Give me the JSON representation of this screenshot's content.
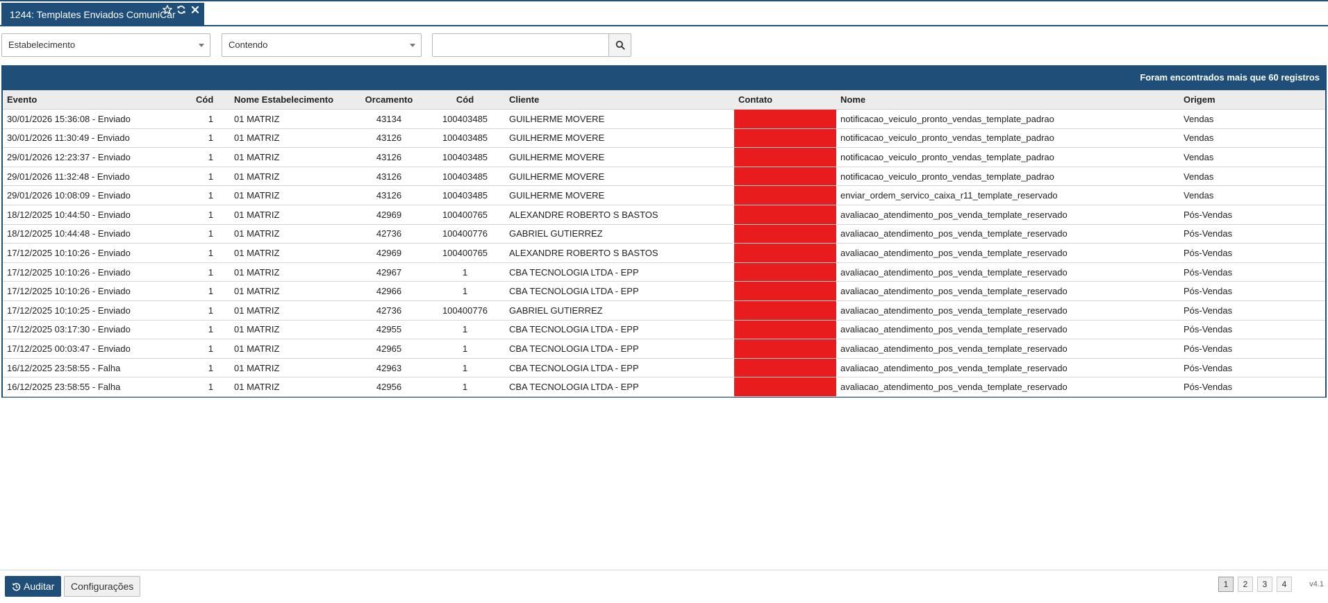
{
  "tab": {
    "title": "1244: Templates Enviados ComuniCar",
    "icons": [
      "star-icon",
      "refresh-icon",
      "close-icon"
    ]
  },
  "filters": {
    "establishment_select": "Estabelecimento",
    "condition_select": "Contendo",
    "search_value": "",
    "search_icon": "search-icon"
  },
  "results": {
    "header_message": "Foram encontrados mais que 60 registros",
    "columns": [
      "Evento",
      "Cód",
      "Nome Estabelecimento",
      "Orcamento",
      "Cód",
      "Cliente",
      "Contato",
      "Nome",
      "Origem"
    ],
    "rows": [
      [
        "30/01/2026 15:36:08 - Enviado",
        "1",
        "01 MATRIZ",
        "43134",
        "100403485",
        "GUILHERME MOVERE",
        "",
        "notificacao_veiculo_pronto_vendas_template_padrao",
        "Vendas"
      ],
      [
        "30/01/2026 11:30:49 - Enviado",
        "1",
        "01 MATRIZ",
        "43126",
        "100403485",
        "GUILHERME MOVERE",
        "",
        "notificacao_veiculo_pronto_vendas_template_padrao",
        "Vendas"
      ],
      [
        "29/01/2026 12:23:37 - Enviado",
        "1",
        "01 MATRIZ",
        "43126",
        "100403485",
        "GUILHERME MOVERE",
        "",
        "notificacao_veiculo_pronto_vendas_template_padrao",
        "Vendas"
      ],
      [
        "29/01/2026 11:32:48 - Enviado",
        "1",
        "01 MATRIZ",
        "43126",
        "100403485",
        "GUILHERME MOVERE",
        "",
        "notificacao_veiculo_pronto_vendas_template_padrao",
        "Vendas"
      ],
      [
        "29/01/2026 10:08:09 - Enviado",
        "1",
        "01 MATRIZ",
        "43126",
        "100403485",
        "GUILHERME MOVERE",
        "",
        "enviar_ordem_servico_caixa_r11_template_reservado",
        "Vendas"
      ],
      [
        "18/12/2025 10:44:50 - Enviado",
        "1",
        "01 MATRIZ",
        "42969",
        "100400765",
        "ALEXANDRE ROBERTO S BASTOS",
        "",
        "avaliacao_atendimento_pos_venda_template_reservado",
        "Pós-Vendas"
      ],
      [
        "18/12/2025 10:44:48 - Enviado",
        "1",
        "01 MATRIZ",
        "42736",
        "100400776",
        "GABRIEL GUTIERREZ",
        "",
        "avaliacao_atendimento_pos_venda_template_reservado",
        "Pós-Vendas"
      ],
      [
        "17/12/2025 10:10:26 - Enviado",
        "1",
        "01 MATRIZ",
        "42969",
        "100400765",
        "ALEXANDRE ROBERTO S BASTOS",
        "",
        "avaliacao_atendimento_pos_venda_template_reservado",
        "Pós-Vendas"
      ],
      [
        "17/12/2025 10:10:26 - Enviado",
        "1",
        "01 MATRIZ",
        "42967",
        "1",
        "CBA TECNOLOGIA LTDA - EPP",
        "",
        "avaliacao_atendimento_pos_venda_template_reservado",
        "Pós-Vendas"
      ],
      [
        "17/12/2025 10:10:26 - Enviado",
        "1",
        "01 MATRIZ",
        "42966",
        "1",
        "CBA TECNOLOGIA LTDA - EPP",
        "",
        "avaliacao_atendimento_pos_venda_template_reservado",
        "Pós-Vendas"
      ],
      [
        "17/12/2025 10:10:25 - Enviado",
        "1",
        "01 MATRIZ",
        "42736",
        "100400776",
        "GABRIEL GUTIERREZ",
        "",
        "avaliacao_atendimento_pos_venda_template_reservado",
        "Pós-Vendas"
      ],
      [
        "17/12/2025 03:17:30 - Enviado",
        "1",
        "01 MATRIZ",
        "42955",
        "1",
        "CBA TECNOLOGIA LTDA - EPP",
        "",
        "avaliacao_atendimento_pos_venda_template_reservado",
        "Pós-Vendas"
      ],
      [
        "17/12/2025 00:03:47 - Enviado",
        "1",
        "01 MATRIZ",
        "42965",
        "1",
        "CBA TECNOLOGIA LTDA - EPP",
        "",
        "avaliacao_atendimento_pos_venda_template_reservado",
        "Pós-Vendas"
      ],
      [
        "16/12/2025 23:58:55 - Falha",
        "1",
        "01 MATRIZ",
        "42963",
        "1",
        "CBA TECNOLOGIA LTDA - EPP",
        "",
        "avaliacao_atendimento_pos_venda_template_reservado",
        "Pós-Vendas"
      ],
      [
        "16/12/2025 23:58:55 - Falha",
        "1",
        "01 MATRIZ",
        "42956",
        "1",
        "CBA TECNOLOGIA LTDA - EPP",
        "",
        "avaliacao_atendimento_pos_venda_template_reservado",
        "Pós-Vendas"
      ]
    ]
  },
  "footer": {
    "audit_label": "Auditar",
    "audit_icon": "history-icon",
    "settings_label": "Configurações",
    "pages": [
      "1",
      "2",
      "3",
      "4"
    ],
    "active_page": "1",
    "version": "v4.1"
  },
  "colors": {
    "primary": "#1f4e79",
    "redaction": "#e81c1c"
  }
}
